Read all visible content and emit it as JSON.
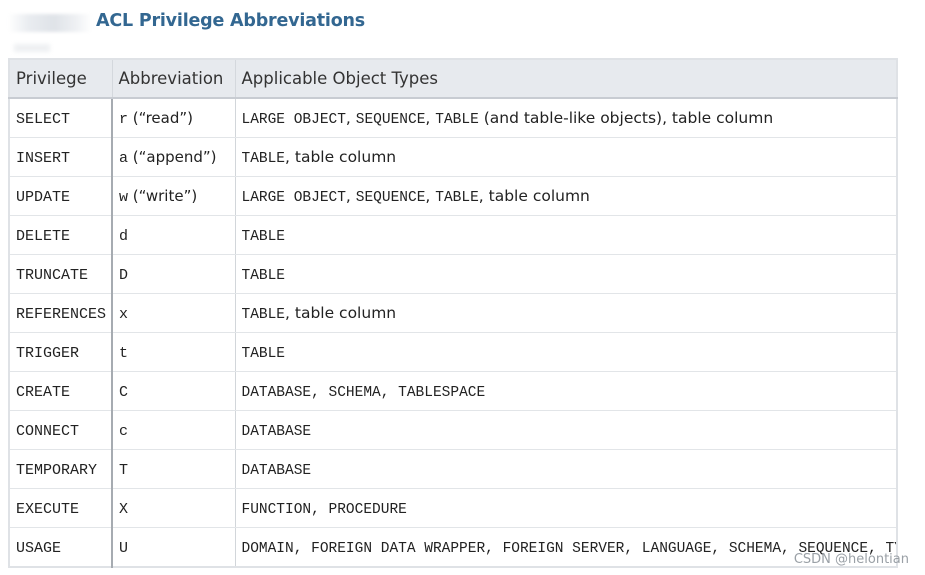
{
  "caption": "ACL Privilege Abbreviations",
  "table": {
    "headers": [
      "Privilege",
      "Abbreviation",
      "Applicable Object Types"
    ],
    "rows": [
      {
        "privilege": "SELECT",
        "abbr": "r",
        "abbr_note": " (“read”)",
        "types": [
          {
            "text": "LARGE OBJECT",
            "code": true
          },
          {
            "text": ", ",
            "code": false
          },
          {
            "text": "SEQUENCE",
            "code": true
          },
          {
            "text": ", ",
            "code": false
          },
          {
            "text": "TABLE",
            "code": true
          },
          {
            "text": " (and table-like objects), table column",
            "code": false
          }
        ]
      },
      {
        "privilege": "INSERT",
        "abbr": "a",
        "abbr_note": " (“append”)",
        "types": [
          {
            "text": "TABLE",
            "code": true
          },
          {
            "text": ", table column",
            "code": false
          }
        ]
      },
      {
        "privilege": "UPDATE",
        "abbr": "w",
        "abbr_note": " (“write”)",
        "types": [
          {
            "text": "LARGE OBJECT",
            "code": true
          },
          {
            "text": ", ",
            "code": false
          },
          {
            "text": "SEQUENCE",
            "code": true
          },
          {
            "text": ", ",
            "code": false
          },
          {
            "text": "TABLE",
            "code": true
          },
          {
            "text": ", table column",
            "code": false
          }
        ]
      },
      {
        "privilege": "DELETE",
        "abbr": "d",
        "abbr_note": "",
        "types": [
          {
            "text": "TABLE",
            "code": true
          }
        ]
      },
      {
        "privilege": "TRUNCATE",
        "abbr": "D",
        "abbr_note": "",
        "types": [
          {
            "text": "TABLE",
            "code": true
          }
        ]
      },
      {
        "privilege": "REFERENCES",
        "abbr": "x",
        "abbr_note": "",
        "types": [
          {
            "text": "TABLE",
            "code": true
          },
          {
            "text": ", table column",
            "code": false
          }
        ]
      },
      {
        "privilege": "TRIGGER",
        "abbr": "t",
        "abbr_note": "",
        "types": [
          {
            "text": "TABLE",
            "code": true
          }
        ]
      },
      {
        "privilege": "CREATE",
        "abbr": "C",
        "abbr_note": "",
        "types": [
          {
            "text": "DATABASE",
            "code": true
          },
          {
            "text": ", ",
            "code": true
          },
          {
            "text": "SCHEMA",
            "code": true
          },
          {
            "text": ", ",
            "code": true
          },
          {
            "text": "TABLESPACE",
            "code": true
          }
        ]
      },
      {
        "privilege": "CONNECT",
        "abbr": "c",
        "abbr_note": "",
        "types": [
          {
            "text": "DATABASE",
            "code": true
          }
        ]
      },
      {
        "privilege": "TEMPORARY",
        "abbr": "T",
        "abbr_note": "",
        "types": [
          {
            "text": "DATABASE",
            "code": true
          }
        ]
      },
      {
        "privilege": "EXECUTE",
        "abbr": "X",
        "abbr_note": "",
        "types": [
          {
            "text": "FUNCTION",
            "code": true
          },
          {
            "text": ", ",
            "code": true
          },
          {
            "text": "PROCEDURE",
            "code": true
          }
        ]
      },
      {
        "privilege": "USAGE",
        "abbr": "U",
        "abbr_note": "",
        "types": [
          {
            "text": "DOMAIN",
            "code": true
          },
          {
            "text": ", ",
            "code": true
          },
          {
            "text": "FOREIGN DATA WRAPPER",
            "code": true
          },
          {
            "text": ", ",
            "code": true
          },
          {
            "text": "FOREIGN SERVER",
            "code": true
          },
          {
            "text": ", ",
            "code": true
          },
          {
            "text": "LANGUAGE",
            "code": true
          },
          {
            "text": ", ",
            "code": true
          },
          {
            "text": "SCHEMA",
            "code": true
          },
          {
            "text": ", ",
            "code": true
          },
          {
            "text": "SEQUENCE",
            "code": true
          },
          {
            "text": ", ",
            "code": true
          },
          {
            "text": "TYPE",
            "code": true
          }
        ]
      }
    ]
  },
  "watermark": "CSDN @helontian",
  "colors": {
    "caption": "#336791",
    "header_bg": "#e7eaee",
    "border": "#dfe2e6",
    "watermark": "#9aa0a6"
  }
}
